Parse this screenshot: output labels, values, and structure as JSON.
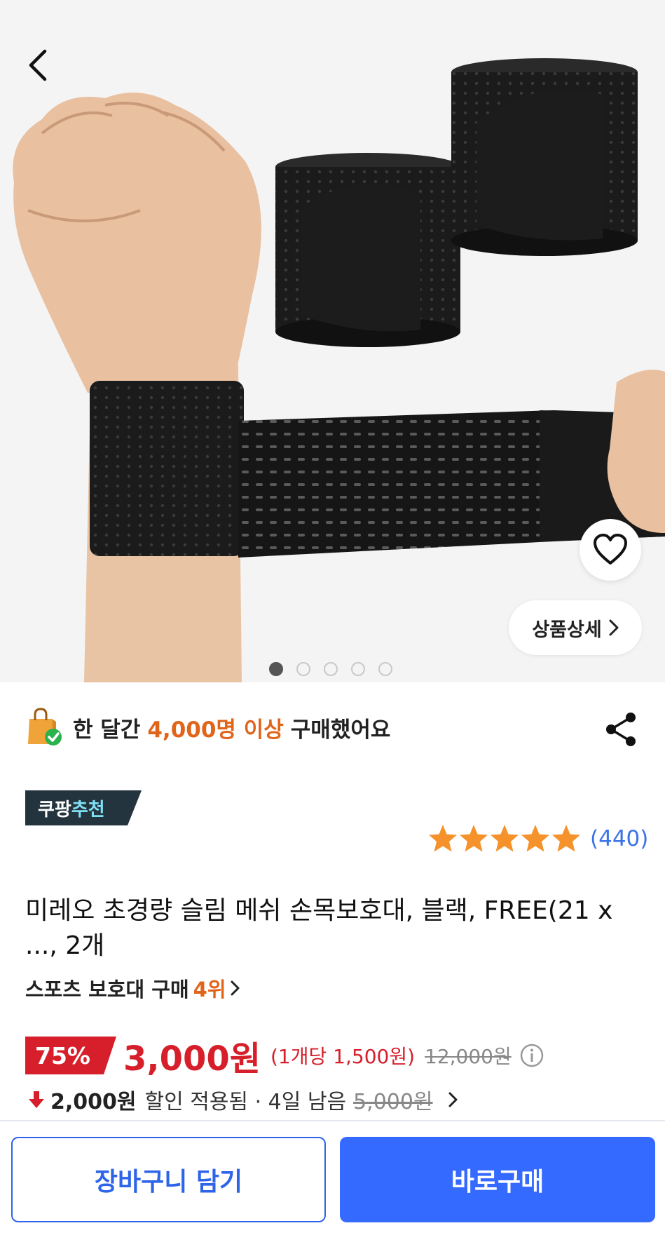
{
  "nav": {
    "back_icon": "chevron-left-icon"
  },
  "gallery": {
    "image_alt": "wrist brace product photo",
    "detail_label": "상품상세",
    "page_count": 5,
    "active_page": 1,
    "wishlist_icon": "heart-icon"
  },
  "notice": {
    "prefix": "한 달간",
    "highlight": "4,000명 이상",
    "suffix": "구매했어요",
    "icon": "shopping-bag-check-icon",
    "share_icon": "share-icon"
  },
  "badge": {
    "part1": "쿠팡",
    "part2": "추천"
  },
  "rating": {
    "stars": 5,
    "count": "(440)"
  },
  "product": {
    "title": "미레오 초경량 슬림 메쉬 손목보호대, 블랙, FREE(21 x ..., 2개",
    "rank_label": "스포츠 보호대 구매",
    "rank_value": "4위"
  },
  "price": {
    "discount": "75%",
    "sale_price": "3,000원",
    "unit_price": "(1개당 1,500원)",
    "original_price": "12,000원"
  },
  "coupon": {
    "amount": "2,000원",
    "text": "할인 적용됨 · 4일 남음",
    "strike_price": "5,000원"
  },
  "actions": {
    "cart": "장바구니 담기",
    "buy": "바로구매"
  },
  "colors": {
    "accent": "#346aff",
    "sale": "#d61f2b",
    "highlight": "#e0651a",
    "star": "#f5922b"
  }
}
